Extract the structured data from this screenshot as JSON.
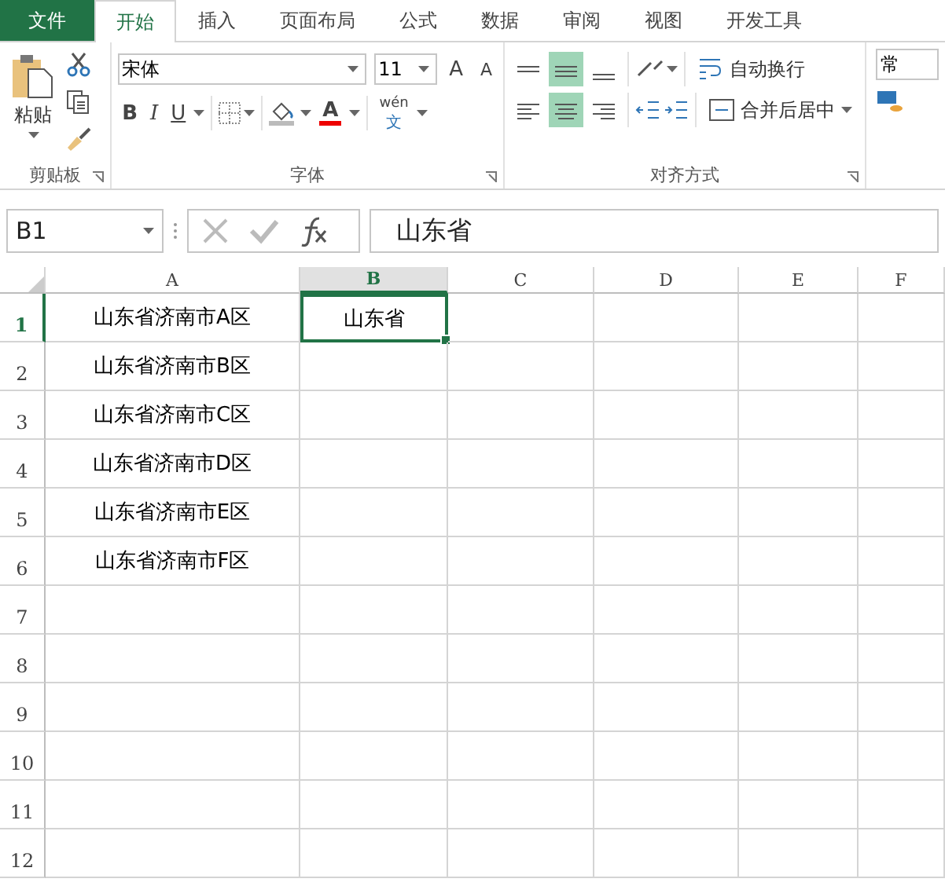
{
  "tabs": [
    {
      "label": "文件",
      "kind": "file",
      "selected": false
    },
    {
      "label": "开始",
      "kind": "tab",
      "selected": true
    },
    {
      "label": "插入",
      "kind": "tab",
      "selected": false
    },
    {
      "label": "页面布局",
      "kind": "tab",
      "selected": false
    },
    {
      "label": "公式",
      "kind": "tab",
      "selected": false
    },
    {
      "label": "数据",
      "kind": "tab",
      "selected": false
    },
    {
      "label": "审阅",
      "kind": "tab",
      "selected": false
    },
    {
      "label": "视图",
      "kind": "tab",
      "selected": false
    },
    {
      "label": "开发工具",
      "kind": "tab",
      "selected": false
    }
  ],
  "ribbon": {
    "clipboard": {
      "paste": "粘贴",
      "label": "剪贴板"
    },
    "font": {
      "name": "宋体",
      "size": "11",
      "grow": "A",
      "shrink": "A",
      "bold": "B",
      "italic": "I",
      "underline": "U",
      "font_color": "A",
      "phonetic_top": "wén",
      "phonetic_bottom": "文",
      "label": "字体"
    },
    "alignment": {
      "top_row": [
        {
          "kind": "top",
          "selected": false
        },
        {
          "kind": "middle",
          "selected": true
        },
        {
          "kind": "bottom",
          "selected": false
        }
      ],
      "bottom_row": [
        {
          "kind": "left",
          "selected": false
        },
        {
          "kind": "center",
          "selected": true
        },
        {
          "kind": "right",
          "selected": false
        }
      ],
      "wrap": "自动换行",
      "merge": "合并后居中",
      "label": "对齐方式"
    },
    "number": {
      "format": "常"
    }
  },
  "formula_bar": {
    "name_box": "B1",
    "value": "山东省"
  },
  "columns": [
    {
      "label": "A",
      "selected": false
    },
    {
      "label": "B",
      "selected": true
    },
    {
      "label": "C",
      "selected": false
    },
    {
      "label": "D",
      "selected": false
    },
    {
      "label": "E",
      "selected": false
    },
    {
      "label": "F",
      "selected": false
    }
  ],
  "rows": [
    {
      "number": "1",
      "selected": true,
      "cells": [
        "山东省济南市A区",
        "山东省"
      ]
    },
    {
      "number": "2",
      "selected": false,
      "cells": [
        "山东省济南市B区"
      ]
    },
    {
      "number": "3",
      "selected": false,
      "cells": [
        "山东省济南市C区"
      ]
    },
    {
      "number": "4",
      "selected": false,
      "cells": [
        "山东省济南市D区"
      ]
    },
    {
      "number": "5",
      "selected": false,
      "cells": [
        "山东省济南市E区"
      ]
    },
    {
      "number": "6",
      "selected": false,
      "cells": [
        "山东省济南市F区"
      ]
    },
    {
      "number": "7",
      "selected": false,
      "cells": []
    },
    {
      "number": "8",
      "selected": false,
      "cells": []
    },
    {
      "number": "9",
      "selected": false,
      "cells": []
    },
    {
      "number": "10",
      "selected": false,
      "cells": []
    },
    {
      "number": "11",
      "selected": false,
      "cells": []
    },
    {
      "number": "12",
      "selected": false,
      "cells": []
    }
  ]
}
